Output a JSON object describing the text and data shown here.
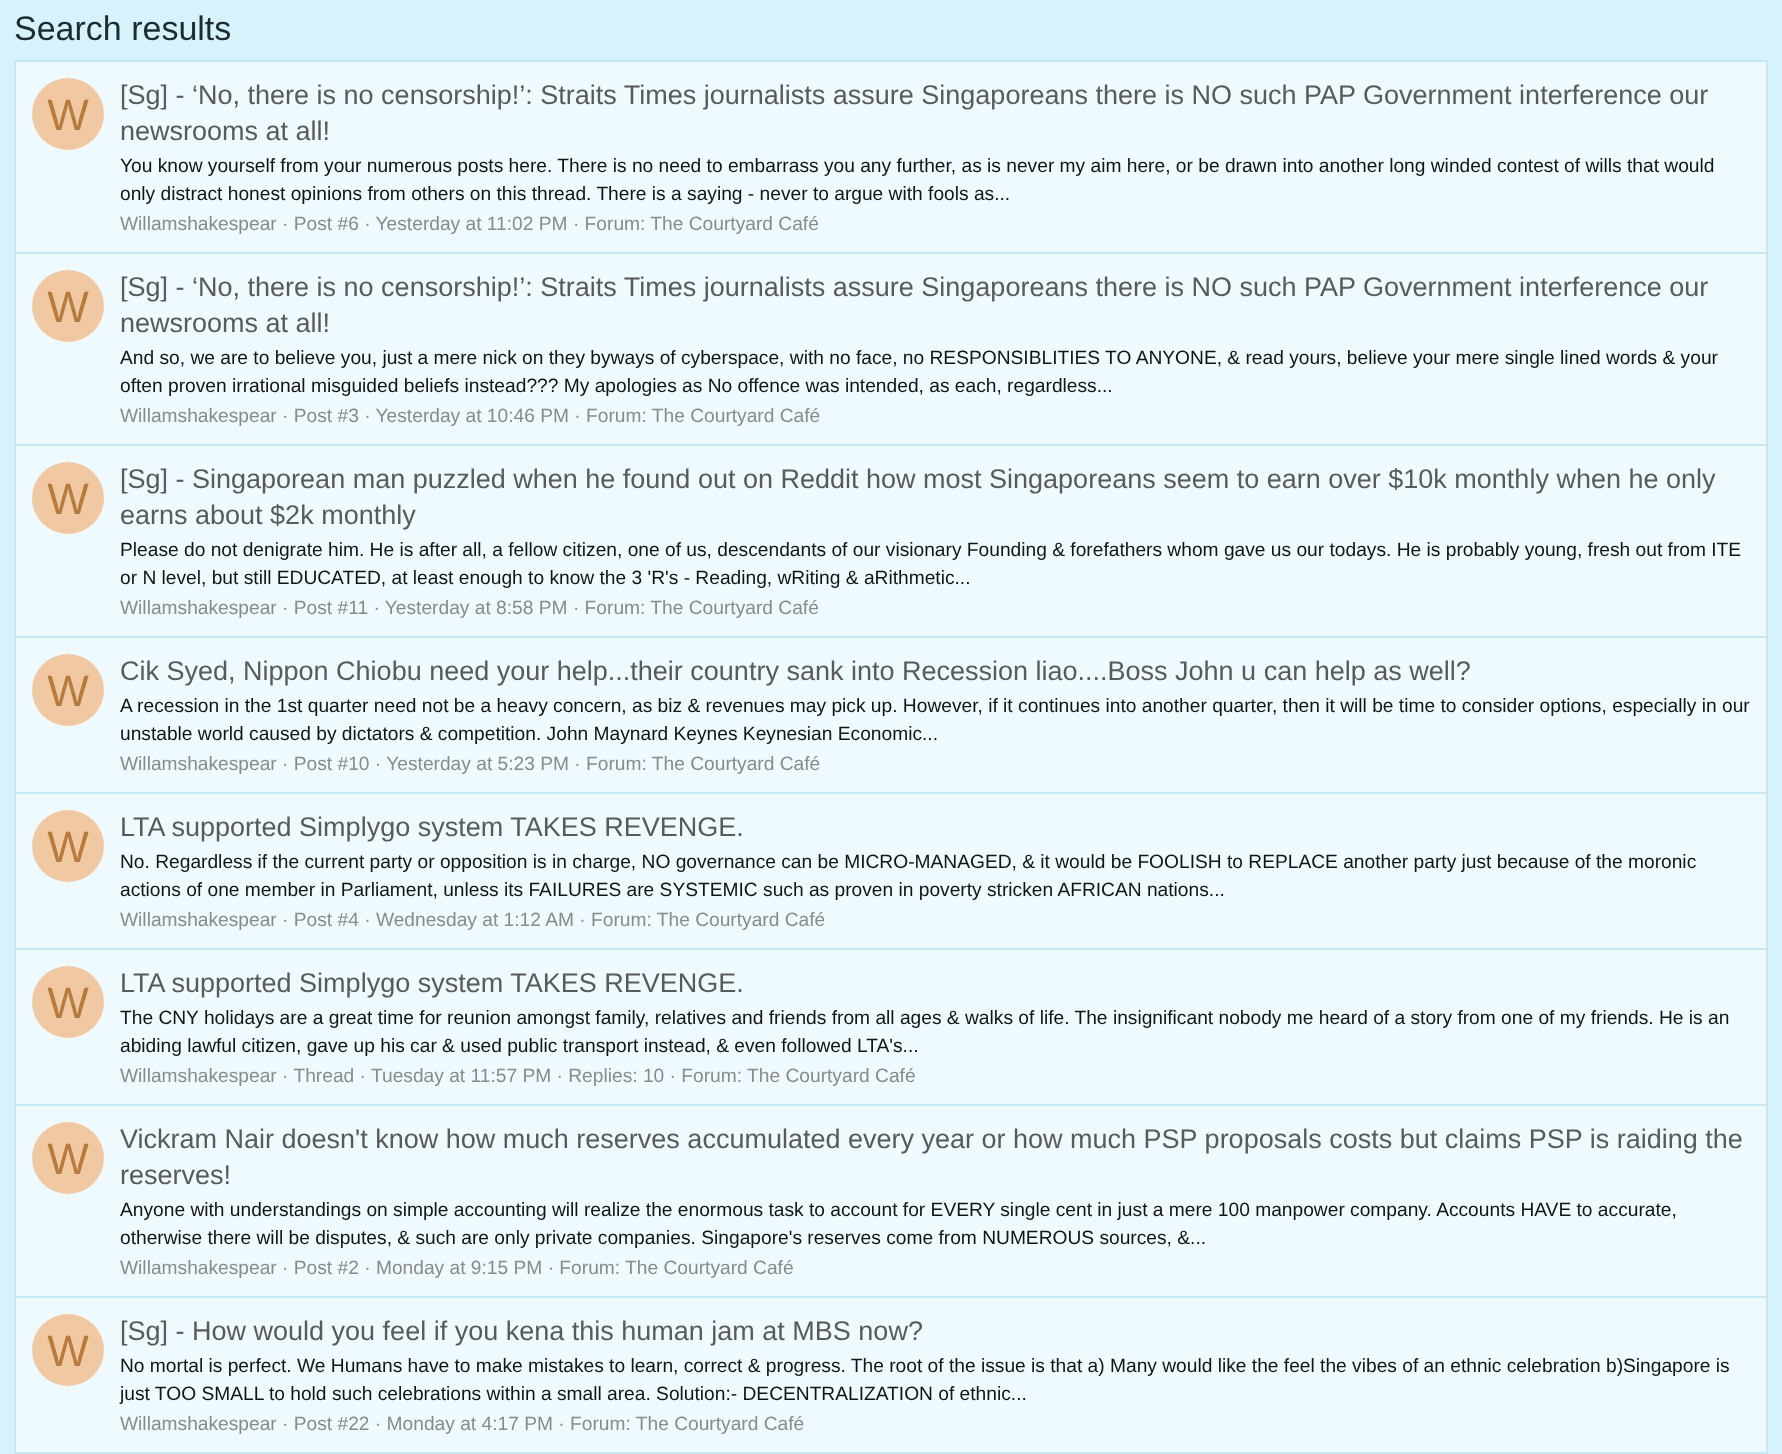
{
  "header": {
    "title": "Search results"
  },
  "results": [
    {
      "avatar": "W",
      "title": "[Sg] - ‘No, there is no censorship!’: Straits Times journalists assure Singaporeans there is NO such PAP Government interference our newsrooms at all!",
      "snippet": "You know yourself from your numerous posts here. There is no need to embarrass you any further, as is never my aim here, or be drawn into another long winded contest of wills that would only distract honest opinions from others on this thread. There is a saying - never to argue with fools as...",
      "meta": "Willamshakespear · Post #6 · Yesterday at 11:02 PM · Forum: The Courtyard Café"
    },
    {
      "avatar": "W",
      "title": "[Sg] - ‘No, there is no censorship!’: Straits Times journalists assure Singaporeans there is NO such PAP Government interference our newsrooms at all!",
      "snippet": "And so, we are to believe you, just a mere nick on they byways of cyberspace, with no face, no RESPONSIBLITIES TO ANYONE, & read yours, believe your mere single lined words & your often proven irrational misguided beliefs instead??? My apologies as No offence was intended, as each, regardless...",
      "meta": "Willamshakespear · Post #3 · Yesterday at 10:46 PM · Forum: The Courtyard Café"
    },
    {
      "avatar": "W",
      "title": "[Sg] - Singaporean man puzzled when he found out on Reddit how most Singaporeans seem to earn over $10k monthly when he only earns about $2k monthly",
      "snippet": "Please do not denigrate him. He is after all, a fellow citizen, one of us, descendants of our visionary Founding & forefathers whom gave us our todays. He is probably young, fresh out from ITE or N level, but still EDUCATED, at least enough to know the 3 'R's - Reading, wRiting & aRithmetic...",
      "meta": "Willamshakespear · Post #11 · Yesterday at 8:58 PM · Forum: The Courtyard Café"
    },
    {
      "avatar": "W",
      "title": "Cik Syed, Nippon Chiobu need your help...their country sank into Recession liao....Boss John u can help as well?",
      "snippet": "A recession in the 1st quarter need not be a heavy concern, as biz & revenues may pick up. However, if it continues into another quarter, then it will be time to consider options, especially in our unstable world caused by dictators & competition. John Maynard Keynes Keynesian Economic...",
      "meta": "Willamshakespear · Post #10 · Yesterday at 5:23 PM · Forum: The Courtyard Café"
    },
    {
      "avatar": "W",
      "title": "LTA supported Simplygo system TAKES REVENGE.",
      "snippet": "No. Regardless if the current party or opposition is in charge, NO governance can be MICRO-MANAGED, & it would be FOOLISH to REPLACE another party just because of the moronic actions of one member in Parliament, unless its FAILURES are SYSTEMIC such as proven in poverty stricken AFRICAN nations...",
      "meta": "Willamshakespear · Post #4 · Wednesday at 1:12 AM · Forum: The Courtyard Café"
    },
    {
      "avatar": "W",
      "title": "LTA supported Simplygo system TAKES REVENGE.",
      "snippet": "The CNY holidays are a great time for reunion amongst family, relatives and friends from all ages & walks of life. The insignificant nobody me heard of a story from one of my friends. He is an abiding lawful citizen, gave up his car & used public transport instead, & even followed LTA's...",
      "meta": "Willamshakespear · Thread · Tuesday at 11:57 PM · Replies: 10 · Forum: The Courtyard Café"
    },
    {
      "avatar": "W",
      "title": "Vickram Nair doesn't know how much reserves accumulated every year or how much PSP proposals costs but claims PSP is raiding the reserves!",
      "snippet": "Anyone with understandings on simple accounting will realize the enormous task to account for EVERY single cent in just a mere 100 manpower company. Accounts HAVE to accurate, otherwise there will be disputes, & such are only private companies. Singapore's reserves come from NUMEROUS sources, &...",
      "meta": "Willamshakespear · Post #2 · Monday at 9:15 PM · Forum: The Courtyard Café"
    },
    {
      "avatar": "W",
      "title": "[Sg] - How would you feel if you kena this human jam at MBS now?",
      "snippet": "No mortal is perfect. We Humans have to make mistakes to learn, correct & progress. The root of the issue is that a) Many would like the feel the vibes of an ethnic celebration b)Singapore is just TOO SMALL to hold such celebrations within a small area. Solution:- DECENTRALIZATION of ethnic...",
      "meta": "Willamshakespear · Post #22 · Monday at 4:17 PM · Forum: The Courtyard Café"
    }
  ]
}
